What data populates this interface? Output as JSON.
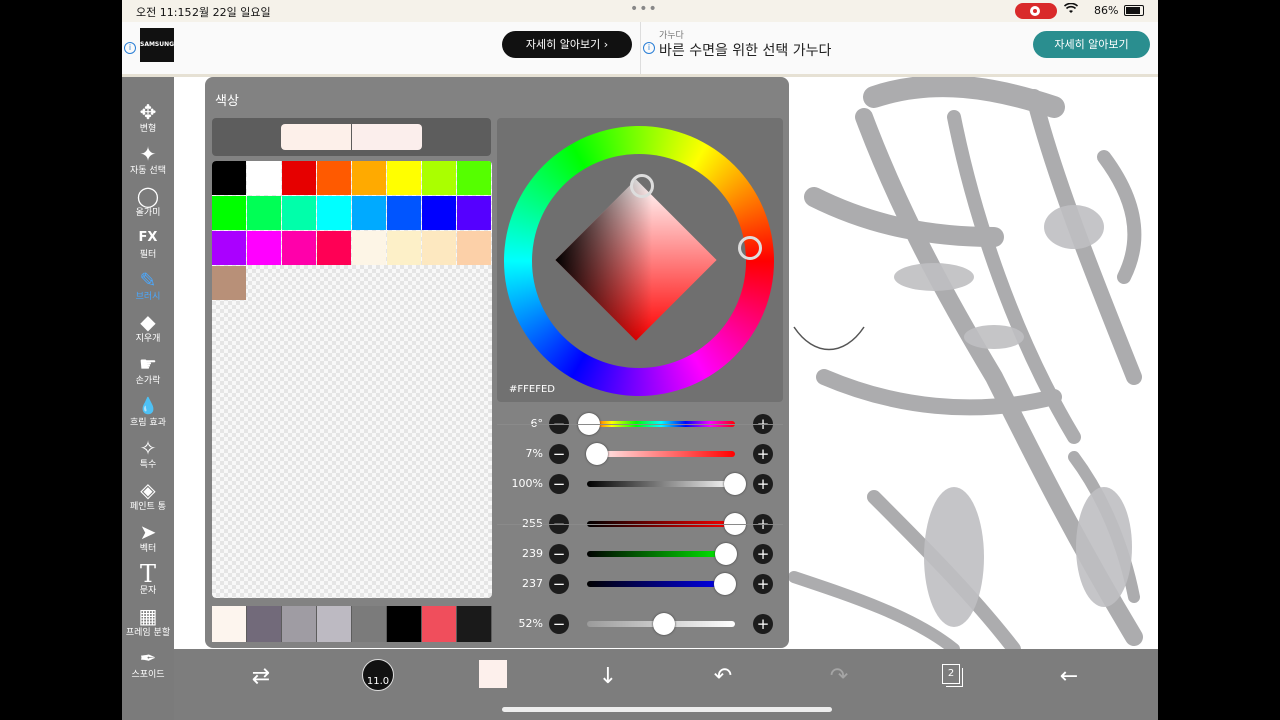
{
  "status_bar": {
    "time": "오전 11:15",
    "date": "2월 22일 일요일",
    "dots": "•••",
    "wifi_icon": "wifi-icon",
    "battery": "86%"
  },
  "ads": {
    "left": {
      "logo": "SAMSUNG",
      "button": "자세히 알아보기 ›"
    },
    "right": {
      "small": "가누다",
      "headline": "바른 수면을 위한 선택 가누다",
      "button": "자세히 알아보기"
    }
  },
  "toolbar": {
    "items": [
      {
        "icon": "✥",
        "label": "변형"
      },
      {
        "icon": "✦",
        "label": "자동 선택"
      },
      {
        "icon": "◯",
        "label": "올가미"
      },
      {
        "icon": "FX",
        "label": "필터"
      },
      {
        "icon": "✎",
        "label": "브러시"
      },
      {
        "icon": "◆",
        "label": "지우개"
      },
      {
        "icon": "☛",
        "label": "손가락"
      },
      {
        "icon": "💧",
        "label": "흐림 효과"
      },
      {
        "icon": "✧",
        "label": "특수"
      },
      {
        "icon": "◈",
        "label": "페인트 통"
      },
      {
        "icon": "➤",
        "label": "벡터"
      },
      {
        "icon": "T",
        "label": "문자"
      },
      {
        "icon": "▦",
        "label": "프레임 분할"
      },
      {
        "icon": "✒",
        "label": "스포이드"
      }
    ]
  },
  "color_panel": {
    "title": "색상",
    "current_colors": [
      "#fdf0ea",
      "#fbeeec"
    ],
    "hex": "#FFEFED",
    "palette": [
      "#000000",
      "#ffffff",
      "#e60000",
      "#ff5a00",
      "#ffaa00",
      "#ffff00",
      "#aaff00",
      "#55ff00",
      "#00ff00",
      "#00ff55",
      "#00ffaa",
      "#00ffff",
      "#00aaff",
      "#0055ff",
      "#0000ff",
      "#5500ff",
      "#aa00ff",
      "#ff00ff",
      "#ff00aa",
      "#ff0055",
      "#fdf5e6",
      "#fdf0c8",
      "#fde8c0",
      "#fcd0a8",
      "#b89078"
    ],
    "recent": [
      "#fdf5ee",
      "#726a7a",
      "#9f9ca3",
      "#bdbac2",
      "#7b7b7b",
      "#000000",
      "#f04e5c",
      "#1a1a1a"
    ],
    "sliders": {
      "hue": {
        "label": "6°",
        "value": 6,
        "max": 360
      },
      "saturation": {
        "label": "7%",
        "value": 7,
        "max": 100
      },
      "brightness": {
        "label": "100%",
        "value": 100,
        "max": 100
      },
      "red": {
        "label": "255",
        "value": 255,
        "max": 255
      },
      "green": {
        "label": "239",
        "value": 239,
        "max": 255
      },
      "blue": {
        "label": "237",
        "value": 237,
        "max": 255
      },
      "opacity": {
        "label": "52%",
        "value": 52,
        "max": 100
      }
    },
    "button_minus": "−",
    "button_plus": "+"
  },
  "bottom_bar": {
    "swap_icon": "⇄",
    "brush_size": "11.0",
    "down_icon": "↓",
    "undo_icon": "↶",
    "redo_icon": "↷",
    "layer_count": "2",
    "back_icon": "←"
  },
  "colors": {
    "toolbar_bg": "#7b7b7b",
    "active_tool": "#4aa8ff",
    "panel_bg": "#787878",
    "ad_teal": "#2a8e8f"
  }
}
